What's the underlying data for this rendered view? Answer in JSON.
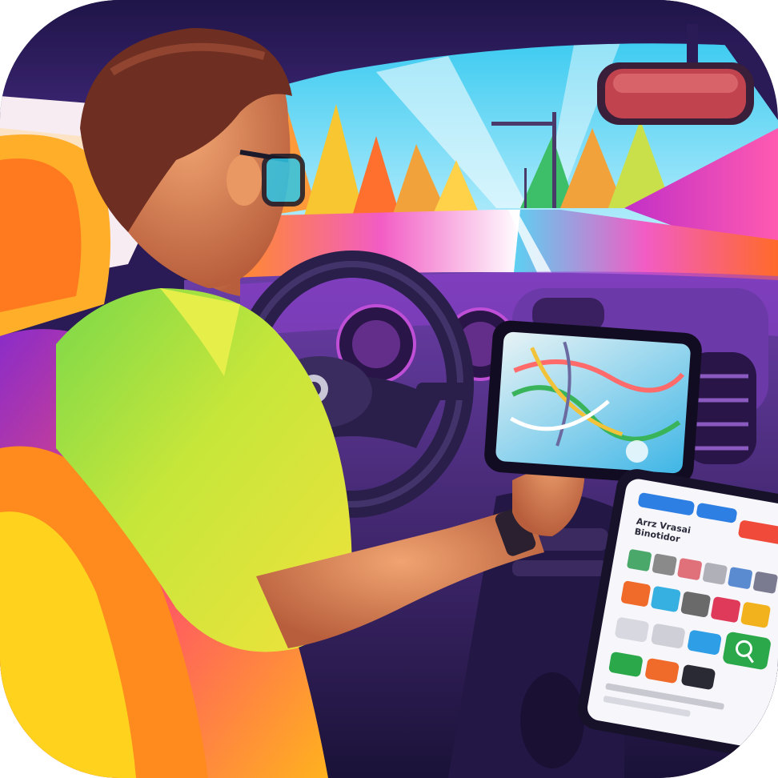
{
  "scene": {
    "subject": "driver-using-in-car-tablet-navigation",
    "palette": {
      "sky": "#4fd6f0",
      "road_pink": "#f25cc4",
      "road_orange": "#ff7a2e",
      "trees_yellow": "#f7c630",
      "shirt_green": "#a6e03a",
      "shirt_yellow": "#d9e83a",
      "interior_purple": "#3a1f6b",
      "dashboard_dark": "#1c1440",
      "seat_orange": "#ff8a1e",
      "seat_purple": "#8a2cc9",
      "hair": "#7a3a2a",
      "skin": "#e0915f"
    }
  },
  "second_tablet": {
    "header_text": "Arrz Vrasai\nBinotidor"
  }
}
